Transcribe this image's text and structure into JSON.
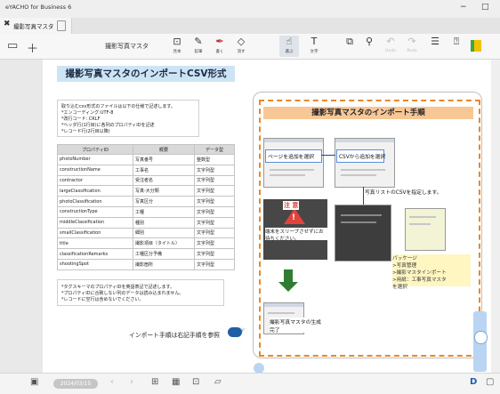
{
  "app": {
    "title": "eYACHO for Business 6"
  },
  "window": {
    "minimize": "−",
    "maximize": "□"
  },
  "tab": {
    "label": "撮影写真マスタ",
    "close": "✖"
  },
  "toolbar": {
    "doc_title": "撮影写真マスタ",
    "tools": [
      {
        "label": "見本",
        "icon": "page-icon"
      },
      {
        "label": "鉛筆",
        "icon": "pencil-icon"
      },
      {
        "label": "書く",
        "icon": "pen-icon"
      },
      {
        "label": "消す",
        "icon": "eraser-icon"
      },
      {
        "label": "選ぶ",
        "icon": "select-icon"
      },
      {
        "label": "文字",
        "icon": "text-icon"
      },
      {
        "label": "",
        "icon": "camera-icon"
      },
      {
        "label": "",
        "icon": "mic-icon"
      },
      {
        "label": "Undo",
        "icon": "undo-icon"
      },
      {
        "label": "Redo",
        "icon": "redo-icon"
      },
      {
        "label": "",
        "icon": "menu-icon"
      },
      {
        "label": "",
        "icon": "help-icon"
      }
    ]
  },
  "page": {
    "title": "撮影写真マスタのインポートCSV形式",
    "spec": [
      "取り込むcsv形式のファイルは以下の仕様で記述します。",
      "*エンコーディング:UTF-8",
      "*改行コード: CRLF",
      "*ヘッダ行(1行目)に各列のプロパティIDを記述",
      "*レコード行(2行目以降)"
    ],
    "table": {
      "headers": [
        "プロパティID",
        "概要",
        "データ型"
      ],
      "rows": [
        [
          "photoNumber",
          "写真番号",
          "整数型"
        ],
        [
          "constructionName",
          "工事名",
          "文字列型"
        ],
        [
          "contractor",
          "受注者名",
          "文字列型"
        ],
        [
          "largeClassification",
          "写真-大分類",
          "文字列型"
        ],
        [
          "photoClassification",
          "写真区分",
          "文字列型"
        ],
        [
          "constructionType",
          "工種",
          "文字列型"
        ],
        [
          "middleClassification",
          "種別",
          "文字列型"
        ],
        [
          "smallClassification",
          "細別",
          "文字列型"
        ],
        [
          "title",
          "撮影項目（タイトル）",
          "文字列型"
        ],
        [
          "classificationRemarks",
          "工種区分予備",
          "文字列型"
        ],
        [
          "shootingSpot",
          "撮影箇所",
          "文字列型"
        ]
      ]
    },
    "notes": [
      "*タグスキーマのプロパティIDを英語表記で記述します。",
      "*プロパティIDに合致しない列のデータは読み込まれません。",
      "*レコードに空行は含めないでください。"
    ],
    "ref_note": "インポート手順は右記手順を参照"
  },
  "procedure": {
    "title": "撮影写真マスタのインポート手順",
    "step1": "ページを追加を選択",
    "step2": "CSVから追加を選択",
    "step3": "写真リストのCSVを指定します。",
    "warning_title": "注 意",
    "warning_text": "端末をスリープさせずにお待ちください。",
    "sticky": [
      "パッケージ",
      ">写真管理",
      ">撮影マスタインポート",
      ">用紙：工事写真マスタ",
      "を選択"
    ],
    "done": "撮影写真マスタの生成完了"
  },
  "bottom": {
    "date": "2024/03/15"
  },
  "colors": {
    "accent": "#1f5fa6",
    "orange": "#e8882a",
    "title_bg": "#cde4f4"
  }
}
